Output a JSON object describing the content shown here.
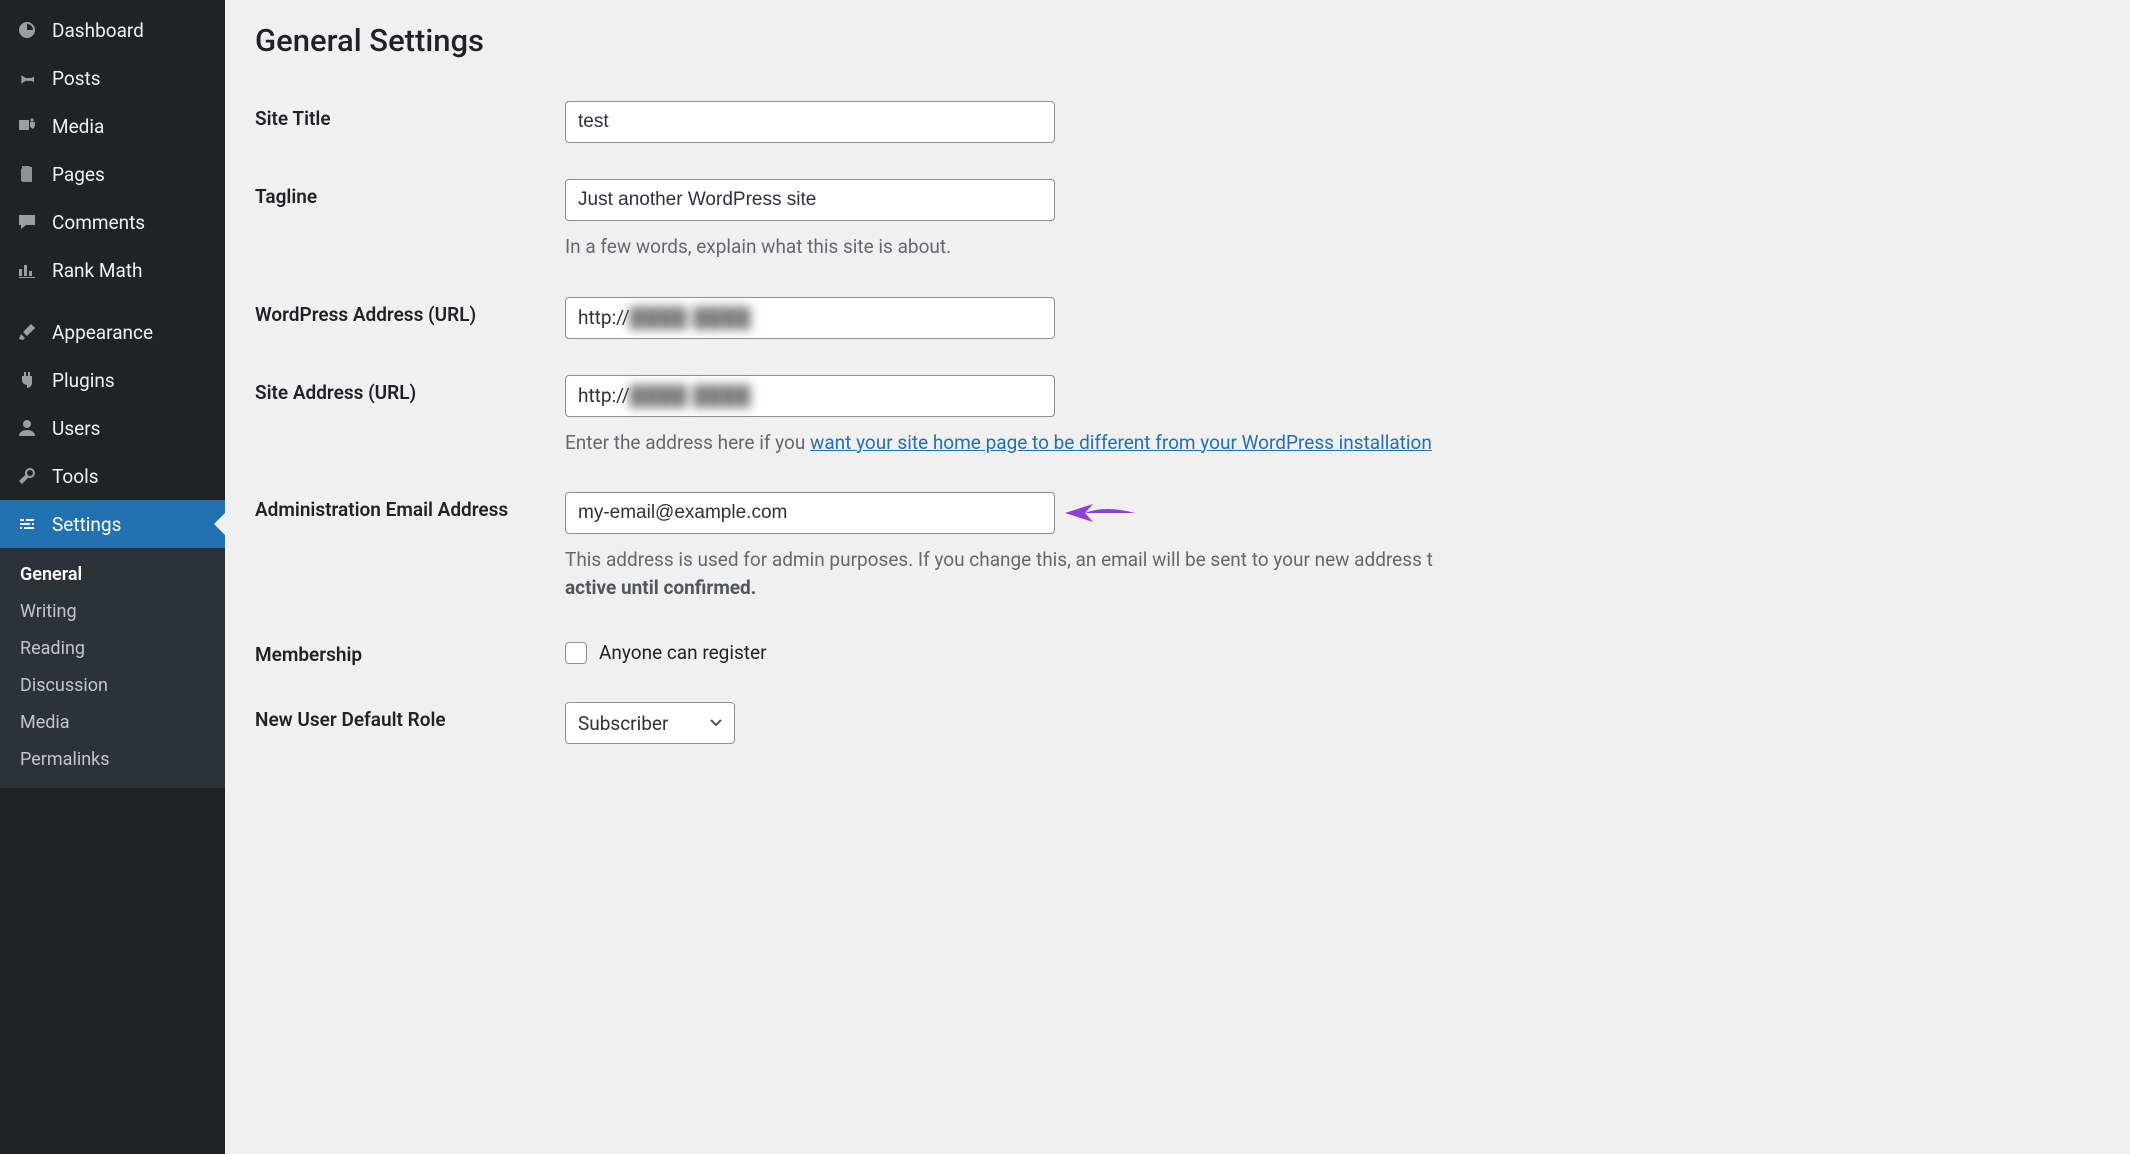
{
  "sidebar": {
    "items": [
      {
        "id": "dashboard",
        "label": "Dashboard",
        "icon": "dashboard"
      },
      {
        "id": "posts",
        "label": "Posts",
        "icon": "pin"
      },
      {
        "id": "media",
        "label": "Media",
        "icon": "media"
      },
      {
        "id": "pages",
        "label": "Pages",
        "icon": "pages"
      },
      {
        "id": "comments",
        "label": "Comments",
        "icon": "comment"
      },
      {
        "id": "rank-math",
        "label": "Rank Math",
        "icon": "chart"
      },
      {
        "id": "appearance",
        "label": "Appearance",
        "icon": "brush"
      },
      {
        "id": "plugins",
        "label": "Plugins",
        "icon": "plug"
      },
      {
        "id": "users",
        "label": "Users",
        "icon": "user"
      },
      {
        "id": "tools",
        "label": "Tools",
        "icon": "wrench"
      },
      {
        "id": "settings",
        "label": "Settings",
        "icon": "sliders",
        "current": true
      }
    ],
    "submenu": [
      "General",
      "Writing",
      "Reading",
      "Discussion",
      "Media",
      "Permalinks"
    ],
    "submenu_current": 0
  },
  "page": {
    "title": "General Settings"
  },
  "fields": {
    "site_title": {
      "label": "Site Title",
      "value": "test"
    },
    "tagline": {
      "label": "Tagline",
      "value": "Just another WordPress site",
      "help": "In a few words, explain what this site is about."
    },
    "wp_url": {
      "label": "WordPress Address (URL)",
      "prefix": "http://",
      "redacted": true
    },
    "site_url": {
      "label": "Site Address (URL)",
      "prefix": "http://",
      "redacted": true,
      "help_pre": "Enter the address here if you ",
      "help_link": "want your site home page to be different from your WordPress installation"
    },
    "admin_email": {
      "label": "Administration Email Address",
      "value": "my-email@example.com",
      "help_plain": "This address is used for admin purposes. If you change this, an email will be sent to your new address t",
      "help_bold": "active until confirmed."
    },
    "membership": {
      "label": "Membership",
      "checkbox_label": "Anyone can register",
      "checked": false
    },
    "default_role": {
      "label": "New User Default Role",
      "value": "Subscriber"
    }
  },
  "annotation": {
    "arrow_color": "#8e3fd6"
  }
}
